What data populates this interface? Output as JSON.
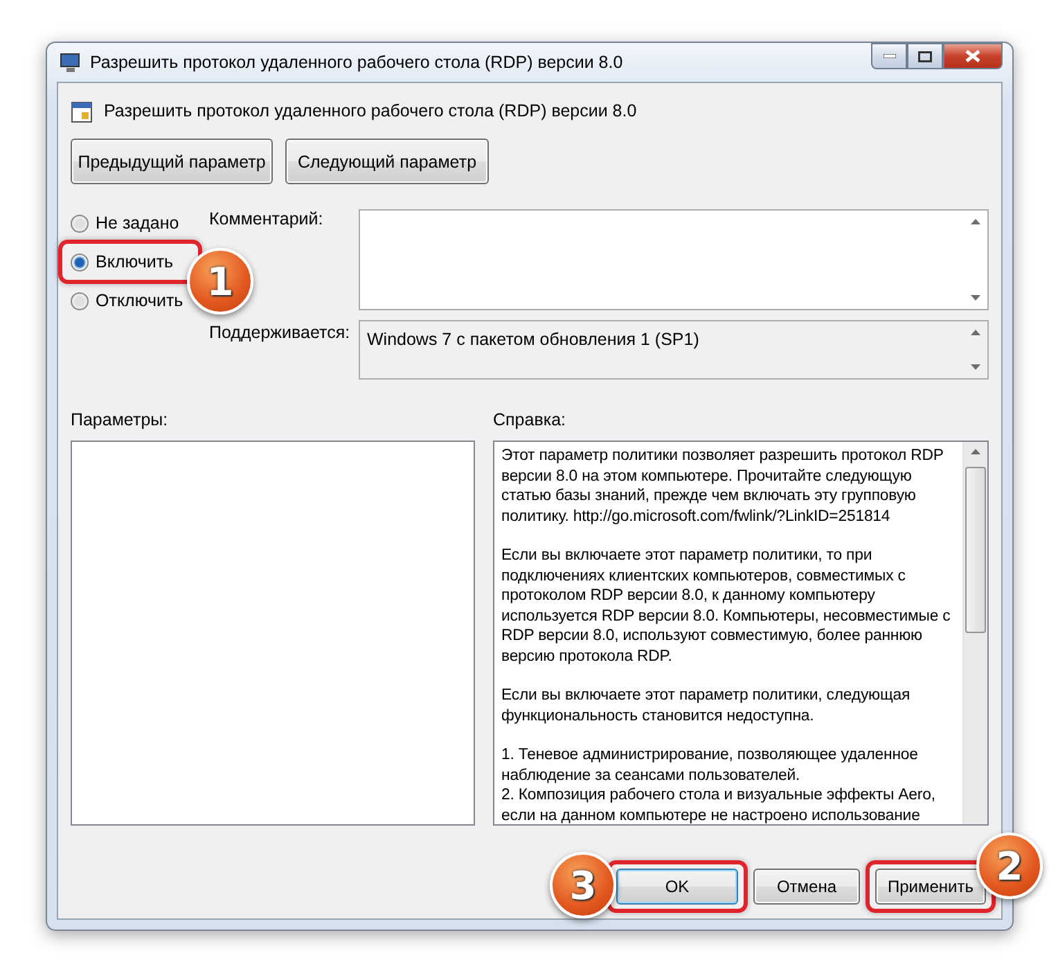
{
  "window": {
    "title": "Разрешить протокол удаленного рабочего стола (RDP) версии 8.0"
  },
  "header": {
    "title": "Разрешить протокол удаленного рабочего стола (RDP) версии 8.0"
  },
  "nav_buttons": [
    "Предыдущий параметр",
    "Следующий параметр"
  ],
  "options": [
    {
      "label": "Не задано",
      "selected": false
    },
    {
      "label": "Включить",
      "selected": true,
      "callout": "1"
    },
    {
      "label": "Отключить",
      "selected": false
    }
  ],
  "comment": {
    "label": "Комментарий:"
  },
  "supported": {
    "label": "Поддерживается:",
    "value": "Windows 7 с пакетом обновления 1 (SP1)"
  },
  "parameters": {
    "label": "Параметры:"
  },
  "help": {
    "label": "Справка:",
    "paragraphs": [
      "Этот параметр политики позволяет разрешить протокол RDP версии 8.0 на этом компьютере. Прочитайте следующую статью базы знаний, прежде чем включать эту групповую политику. http://go.microsoft.com/fwlink/?LinkID=251814",
      "Если вы включаете этот параметр политики, то при подключениях клиентских компьютеров, совместимых с протоколом RDP версии 8.0, к данному компьютеру используется RDP версии 8.0. Компьютеры, несовместимые с RDP версии 8.0, используют совместимую, более раннюю версию протокола RDP.",
      "Если вы включаете этот параметр политики, следующая функциональность становится недоступна.",
      "1. Теневое администрирование, позволяющее удаленное наблюдение за сеансами пользователей.\n2. Композиция рабочего стола и визуальные эффекты Aero, если на данном компьютере не настроено использование"
    ]
  },
  "buttons": [
    {
      "label": "OK",
      "focused": true,
      "callout": "3"
    },
    {
      "label": "Отмена",
      "focused": false
    },
    {
      "label": "Применить",
      "focused": false,
      "callout": "2"
    }
  ]
}
